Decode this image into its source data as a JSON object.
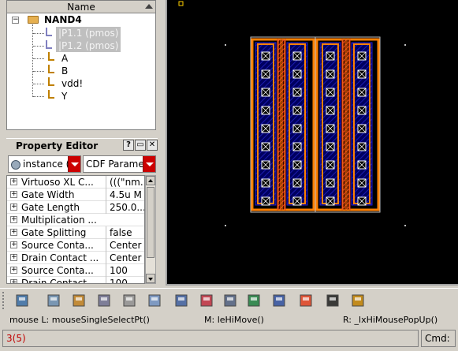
{
  "tree": {
    "header": "Name",
    "root": "NAND4",
    "items": [
      "|P1.1  (pmos)",
      "|P1.2  (pmos)",
      "A",
      "B",
      "vdd!",
      "Y"
    ]
  },
  "property_editor": {
    "title": "Property Editor",
    "help_btn": "?",
    "restore_btn": "▭",
    "close_btn": "✕",
    "filter_value": "instance (",
    "category_value": "CDF Paramet",
    "rows": [
      {
        "expand": "+",
        "name": "Virtuoso XL C...",
        "value": "(((\"nm..."
      },
      {
        "expand": "+",
        "name": "Gate Width",
        "value": "4.5u M"
      },
      {
        "expand": "+",
        "name": "Gate Length",
        "value": "250.0..."
      },
      {
        "expand": "+",
        "name": "Multiplication ...",
        "value": ""
      },
      {
        "expand": "+",
        "name": "Gate Splitting",
        "value": "false"
      },
      {
        "expand": "+",
        "name": "Source Conta...",
        "value": "Center"
      },
      {
        "expand": "+",
        "name": "Drain Contact ...",
        "value": "Center"
      },
      {
        "expand": "+",
        "name": "Source Conta...",
        "value": "100"
      },
      {
        "expand": "+",
        "name": "Drain Contact...",
        "value": "100"
      }
    ]
  },
  "toolbar": {
    "icons": [
      "hierarchy-icon",
      "descend-icon",
      "person-icon",
      "wrench-icon",
      "chain-icon",
      "reshape-icon",
      "window-icon",
      "funnel-icon",
      "grid-icon",
      "probe-icon",
      "align-icon",
      "explode-icon",
      "layer-icon",
      "pins-icon"
    ]
  },
  "status": {
    "mouse_l": "mouse L: mouseSingleSelectPt()",
    "mouse_m": "M: leHiMove()",
    "mouse_r": "R: _lxHiMousePopUp()"
  },
  "cmdline": {
    "left": "3(5)",
    "right": "Cmd:"
  },
  "colors": {
    "metal_orange": "#ff8000",
    "poly_red": "#e03030",
    "diff_blue": "#0000a0",
    "contact_white": "#ffffff",
    "background": "#000000"
  }
}
